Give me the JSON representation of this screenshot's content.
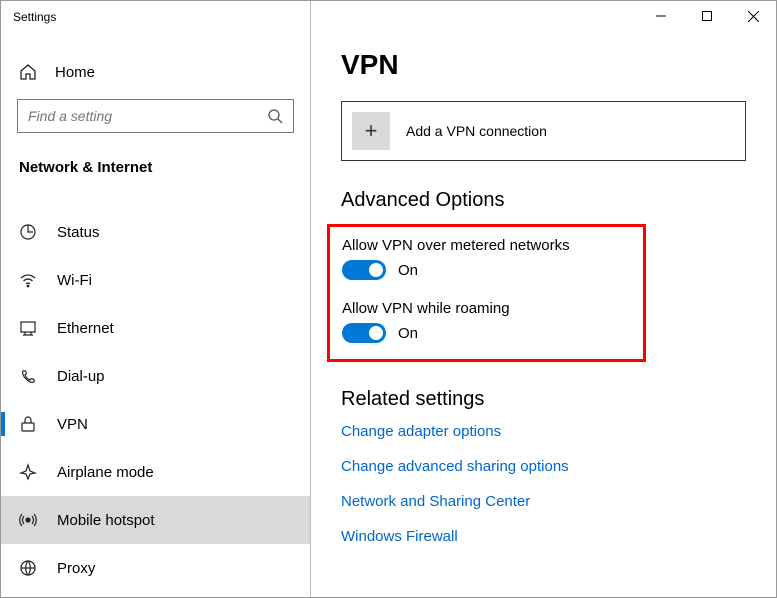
{
  "window": {
    "title": "Settings"
  },
  "home_label": "Home",
  "search": {
    "placeholder": "Find a setting"
  },
  "category": "Network & Internet",
  "nav": [
    {
      "label": "Status"
    },
    {
      "label": "Wi-Fi"
    },
    {
      "label": "Ethernet"
    },
    {
      "label": "Dial-up"
    },
    {
      "label": "VPN"
    },
    {
      "label": "Airplane mode"
    },
    {
      "label": "Mobile hotspot"
    },
    {
      "label": "Proxy"
    }
  ],
  "page": {
    "title": "VPN",
    "add_connection": "Add a VPN connection",
    "advanced_title": "Advanced Options",
    "setting_metered": "Allow VPN over metered networks",
    "setting_roaming": "Allow VPN while roaming",
    "toggle_on": "On",
    "related_title": "Related settings",
    "related_links": [
      "Change adapter options",
      "Change advanced sharing options",
      "Network and Sharing Center",
      "Windows Firewall"
    ]
  }
}
